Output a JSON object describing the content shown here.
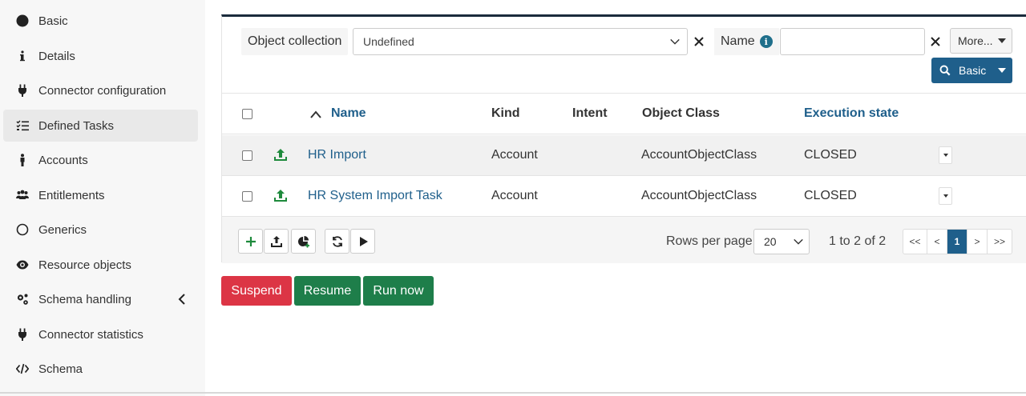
{
  "sidebar": {
    "items": [
      {
        "label": "Basic",
        "icon": "circle-filled-icon"
      },
      {
        "label": "Details",
        "icon": "info-icon"
      },
      {
        "label": "Connector configuration",
        "icon": "plug-icon"
      },
      {
        "label": "Defined Tasks",
        "icon": "tasks-list-icon",
        "active": true
      },
      {
        "label": "Accounts",
        "icon": "person-icon"
      },
      {
        "label": "Entitlements",
        "icon": "users-icon"
      },
      {
        "label": "Generics",
        "icon": "circle-outline-icon"
      },
      {
        "label": "Resource objects",
        "icon": "eye-icon"
      },
      {
        "label": "Schema handling",
        "icon": "cogs-icon"
      },
      {
        "label": "Connector statistics",
        "icon": "plug-icon"
      },
      {
        "label": "Schema",
        "icon": "code-icon"
      }
    ]
  },
  "filters": {
    "object_collection_label": "Object collection",
    "object_collection_value": "Undefined",
    "name_label": "Name",
    "name_value": "",
    "more_label": "More...",
    "basic_label": "Basic"
  },
  "table": {
    "columns": {
      "name": "Name",
      "kind": "Kind",
      "intent": "Intent",
      "object_class": "Object Class",
      "execution_state": "Execution state"
    },
    "rows": [
      {
        "name": "HR Import",
        "kind": "Account",
        "intent": "",
        "object_class": "AccountObjectClass",
        "execution_state": "CLOSED"
      },
      {
        "name": "HR System Import Task",
        "kind": "Account",
        "intent": "",
        "object_class": "AccountObjectClass",
        "execution_state": "CLOSED"
      }
    ]
  },
  "footer": {
    "rows_per_page_label": "Rows per page",
    "rows_per_page_value": "20",
    "range_label": "1 to 2 of 2",
    "pager": {
      "first": "<<",
      "prev": "<",
      "current": "1",
      "next": ">",
      "last": ">>"
    }
  },
  "actions": {
    "suspend": "Suspend",
    "resume": "Resume",
    "run_now": "Run now"
  },
  "colors": {
    "accent": "#1f5f8b",
    "danger": "#dc3545",
    "success": "#1e7e4a",
    "icon_green": "#1e8a3c"
  }
}
